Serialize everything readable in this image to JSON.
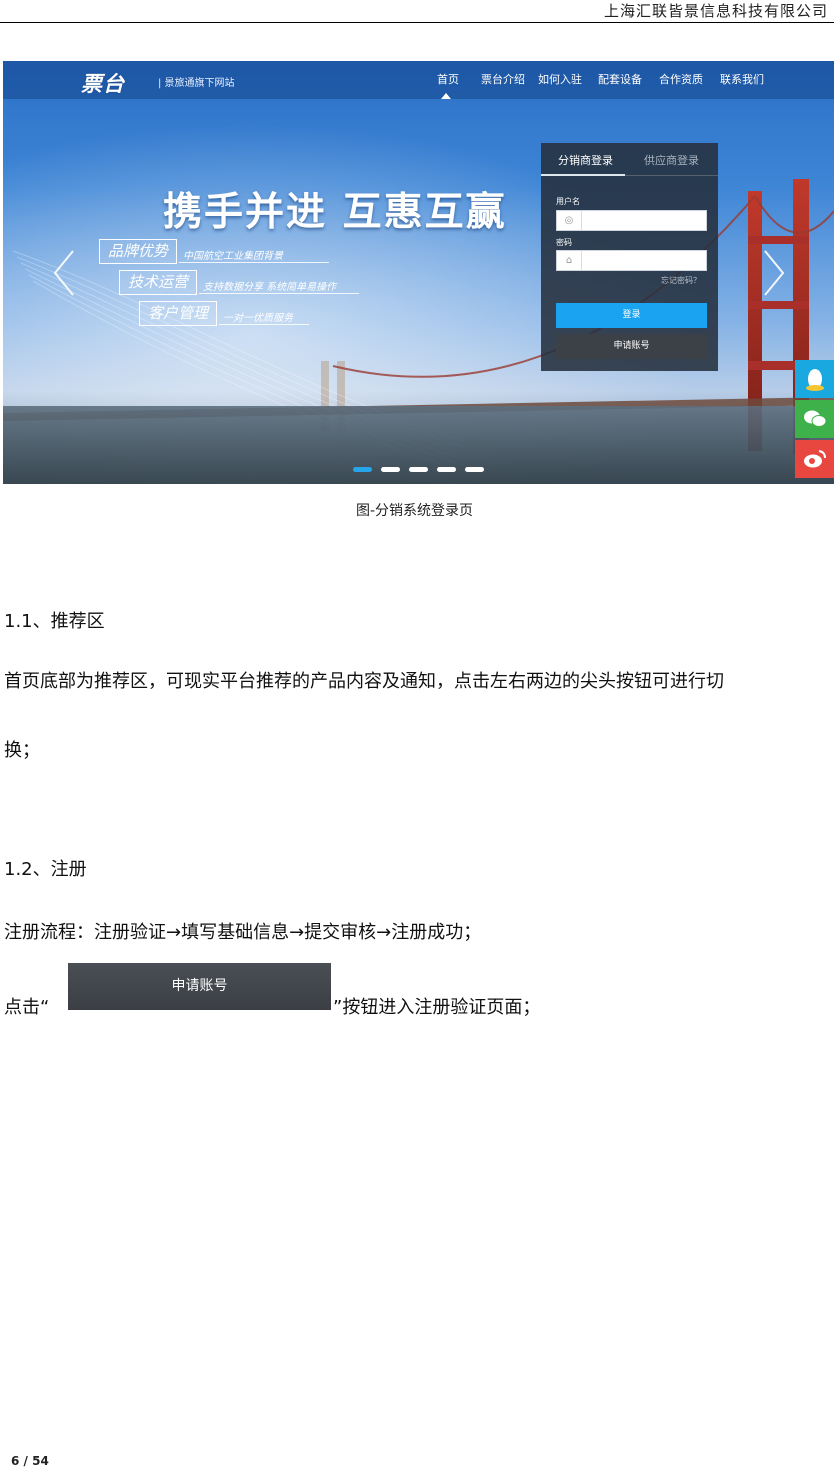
{
  "header": {
    "company": "上海汇联皆景信息科技有限公司"
  },
  "screenshot": {
    "logo": "票台",
    "logo_sub": "| 景旅通旗下网站",
    "nav": [
      "首页",
      "票台介绍",
      "如何入驻",
      "配套设备",
      "合作资质",
      "联系我们"
    ],
    "slogan": "携手并进 互惠互赢",
    "features": [
      {
        "title": "品牌优势",
        "desc": "中国航空工业集团背景"
      },
      {
        "title": "技术运营",
        "desc": "支持数据分享 系统简单易操作"
      },
      {
        "title": "客户管理",
        "desc": "一对一优质服务"
      }
    ],
    "login": {
      "tab_active": "分销商登录",
      "tab_inactive": "供应商登录",
      "username_label": "用户名",
      "password_label": "密码",
      "forgot": "忘记密码？",
      "login_button": "登录",
      "apply_button": "申请账号"
    },
    "carousel_dots": 5
  },
  "caption": "图-分销系统登录页",
  "section1": {
    "heading": "1.1、推荐区",
    "body_line1": "首页底部为推荐区，可现实平台推荐的产品内容及通知，点击左右两边的尖头按钮可进行切",
    "body_line2": "换；"
  },
  "section2": {
    "heading": "1.2、注册",
    "flow": "注册流程：注册验证→填写基础信息→提交审核→注册成功；",
    "click_prefix": "点击“",
    "button_label": "申请账号",
    "click_suffix": "”按钮进入注册验证页面；"
  },
  "footer": {
    "page": "6 / 54"
  }
}
